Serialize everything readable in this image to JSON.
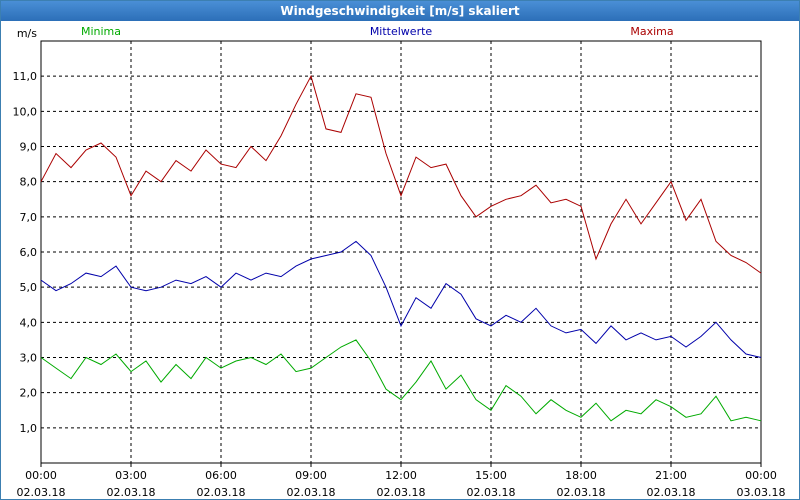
{
  "window": {
    "title": "Windgeschwindigkeit [m/s] skaliert"
  },
  "colors": {
    "minima": "#00aa00",
    "mittel": "#0000aa",
    "maxima": "#aa0000",
    "grid": "#000000"
  },
  "chart_data": {
    "type": "line",
    "title": "Windgeschwindigkeit [m/s] skaliert",
    "ylabel": "m/s",
    "ylim": [
      0.0,
      12.0
    ],
    "xlim": [
      0,
      24
    ],
    "grid": true,
    "legend_placement": "top",
    "y_ticks": [
      "1,0",
      "2,0",
      "3,0",
      "4,0",
      "5,0",
      "6,0",
      "7,0",
      "8,0",
      "9,0",
      "10,0",
      "11,0"
    ],
    "y_tick_values": [
      1,
      2,
      3,
      4,
      5,
      6,
      7,
      8,
      9,
      10,
      11
    ],
    "x_ticks": [
      {
        "time": "00:00",
        "date": "02.03.18"
      },
      {
        "time": "03:00",
        "date": "02.03.18"
      },
      {
        "time": "06:00",
        "date": "02.03.18"
      },
      {
        "time": "09:00",
        "date": "02.03.18"
      },
      {
        "time": "12:00",
        "date": "02.03.18"
      },
      {
        "time": "15:00",
        "date": "02.03.18"
      },
      {
        "time": "18:00",
        "date": "02.03.18"
      },
      {
        "time": "21:00",
        "date": "02.03.18"
      },
      {
        "time": "00:00",
        "date": "03.03.18"
      }
    ],
    "x_tick_values": [
      0,
      3,
      6,
      9,
      12,
      15,
      18,
      21,
      24
    ],
    "series": [
      {
        "name": "Minima",
        "color": "#00aa00",
        "x": [
          0,
          0.5,
          1,
          1.5,
          2,
          2.5,
          3,
          3.5,
          4,
          4.5,
          5,
          5.5,
          6,
          6.5,
          7,
          7.5,
          8,
          8.5,
          9,
          9.5,
          10,
          10.5,
          11,
          11.5,
          12,
          12.5,
          13,
          13.5,
          14,
          14.5,
          15,
          15.5,
          16,
          16.5,
          17,
          17.5,
          18,
          18.5,
          19,
          19.5,
          20,
          20.5,
          21,
          21.5,
          22,
          22.5,
          23,
          23.5,
          24
        ],
        "values": [
          3.0,
          2.7,
          2.4,
          3.0,
          2.8,
          3.1,
          2.6,
          2.9,
          2.3,
          2.8,
          2.4,
          3.0,
          2.7,
          2.9,
          3.0,
          2.8,
          3.1,
          2.6,
          2.7,
          3.0,
          3.3,
          3.5,
          2.9,
          2.1,
          1.8,
          2.3,
          2.9,
          2.1,
          2.5,
          1.8,
          1.5,
          2.2,
          1.9,
          1.4,
          1.8,
          1.5,
          1.3,
          1.7,
          1.2,
          1.5,
          1.4,
          1.8,
          1.6,
          1.3,
          1.4,
          1.9,
          1.2,
          1.3,
          1.2
        ]
      },
      {
        "name": "Mittelwerte",
        "color": "#0000aa",
        "x": [
          0,
          0.5,
          1,
          1.5,
          2,
          2.5,
          3,
          3.5,
          4,
          4.5,
          5,
          5.5,
          6,
          6.5,
          7,
          7.5,
          8,
          8.5,
          9,
          9.5,
          10,
          10.5,
          11,
          11.5,
          12,
          12.5,
          13,
          13.5,
          14,
          14.5,
          15,
          15.5,
          16,
          16.5,
          17,
          17.5,
          18,
          18.5,
          19,
          19.5,
          20,
          20.5,
          21,
          21.5,
          22,
          22.5,
          23,
          23.5,
          24
        ],
        "values": [
          5.2,
          4.9,
          5.1,
          5.4,
          5.3,
          5.6,
          5.0,
          4.9,
          5.0,
          5.2,
          5.1,
          5.3,
          5.0,
          5.4,
          5.2,
          5.4,
          5.3,
          5.6,
          5.8,
          5.9,
          6.0,
          6.3,
          5.9,
          5.0,
          3.9,
          4.7,
          4.4,
          5.1,
          4.8,
          4.1,
          3.9,
          4.2,
          4.0,
          4.4,
          3.9,
          3.7,
          3.8,
          3.4,
          3.9,
          3.5,
          3.7,
          3.5,
          3.6,
          3.3,
          3.6,
          4.0,
          3.5,
          3.1,
          3.0
        ]
      },
      {
        "name": "Maxima",
        "color": "#aa0000",
        "x": [
          0,
          0.5,
          1,
          1.5,
          2,
          2.5,
          3,
          3.5,
          4,
          4.5,
          5,
          5.5,
          6,
          6.5,
          7,
          7.5,
          8,
          8.5,
          9,
          9.5,
          10,
          10.5,
          11,
          11.5,
          12,
          12.5,
          13,
          13.5,
          14,
          14.5,
          15,
          15.5,
          16,
          16.5,
          17,
          17.5,
          18,
          18.5,
          19,
          19.5,
          20,
          20.5,
          21,
          21.5,
          22,
          22.5,
          23,
          23.5,
          24
        ],
        "values": [
          8.0,
          8.8,
          8.4,
          8.9,
          9.1,
          8.7,
          7.6,
          8.3,
          8.0,
          8.6,
          8.3,
          8.9,
          8.5,
          8.4,
          9.0,
          8.6,
          9.3,
          10.2,
          11.0,
          9.5,
          9.4,
          10.5,
          10.4,
          8.8,
          7.6,
          8.7,
          8.4,
          8.5,
          7.6,
          7.0,
          7.3,
          7.5,
          7.6,
          7.9,
          7.4,
          7.5,
          7.3,
          5.8,
          6.8,
          7.5,
          6.8,
          7.4,
          8.0,
          6.9,
          7.5,
          6.3,
          5.9,
          5.7,
          5.4
        ]
      }
    ]
  }
}
